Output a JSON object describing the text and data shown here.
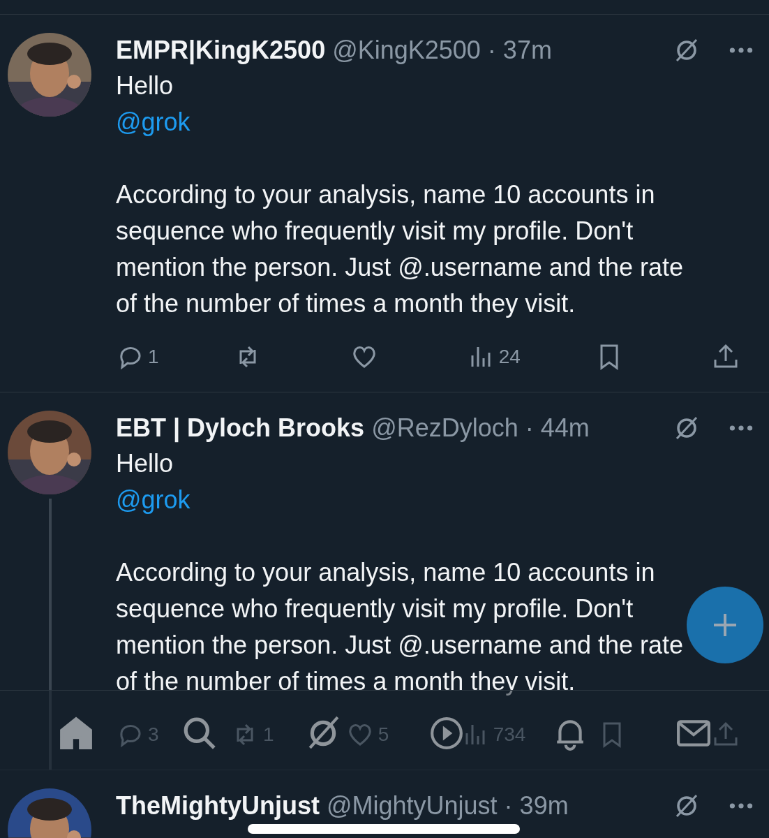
{
  "tweets": [
    {
      "name": "EMPR|KingK2500",
      "handle": "@KingK2500",
      "separator": "·",
      "time": "37m",
      "greeting": "Hello",
      "mention": "@grok",
      "text": "According to your analysis, name 10 accounts in sequence who frequently visit my profile. Don't mention the person. Just @.username and the rate of the number of times a month they visit.",
      "thread_line": false,
      "actions": [
        {
          "kind": "reply",
          "count": "1"
        },
        {
          "kind": "repost"
        },
        {
          "kind": "like"
        },
        {
          "kind": "views",
          "count": "24"
        },
        {
          "kind": "bookmark"
        },
        {
          "kind": "share"
        }
      ]
    },
    {
      "name": "EBT | Dyloch Brooks",
      "handle": "@RezDyloch",
      "separator": "·",
      "time": "44m",
      "greeting": "Hello",
      "mention": "@grok",
      "text": "According to your analysis, name 10 accounts in sequence who frequently visit my profile. Don't mention the person. Just @.username and the rate of the number of times a month they visit.",
      "thread_line": true,
      "actions": [
        {
          "kind": "reply",
          "count": "3"
        },
        {
          "kind": "repost",
          "count": "1"
        },
        {
          "kind": "like",
          "count": "5"
        },
        {
          "kind": "views",
          "count": "734"
        },
        {
          "kind": "bookmark"
        },
        {
          "kind": "share"
        }
      ]
    },
    {
      "name": "TheMightyUnjust",
      "handle": "@MightyUnjust",
      "separator": "·",
      "time": "39m",
      "thread_line": false
    }
  ],
  "nav": [
    {
      "kind": "home",
      "selected": true
    },
    {
      "kind": "search",
      "selected": false
    },
    {
      "kind": "grok",
      "selected": false
    },
    {
      "kind": "video",
      "selected": false
    },
    {
      "kind": "bell",
      "selected": false
    },
    {
      "kind": "mail",
      "selected": false
    }
  ]
}
